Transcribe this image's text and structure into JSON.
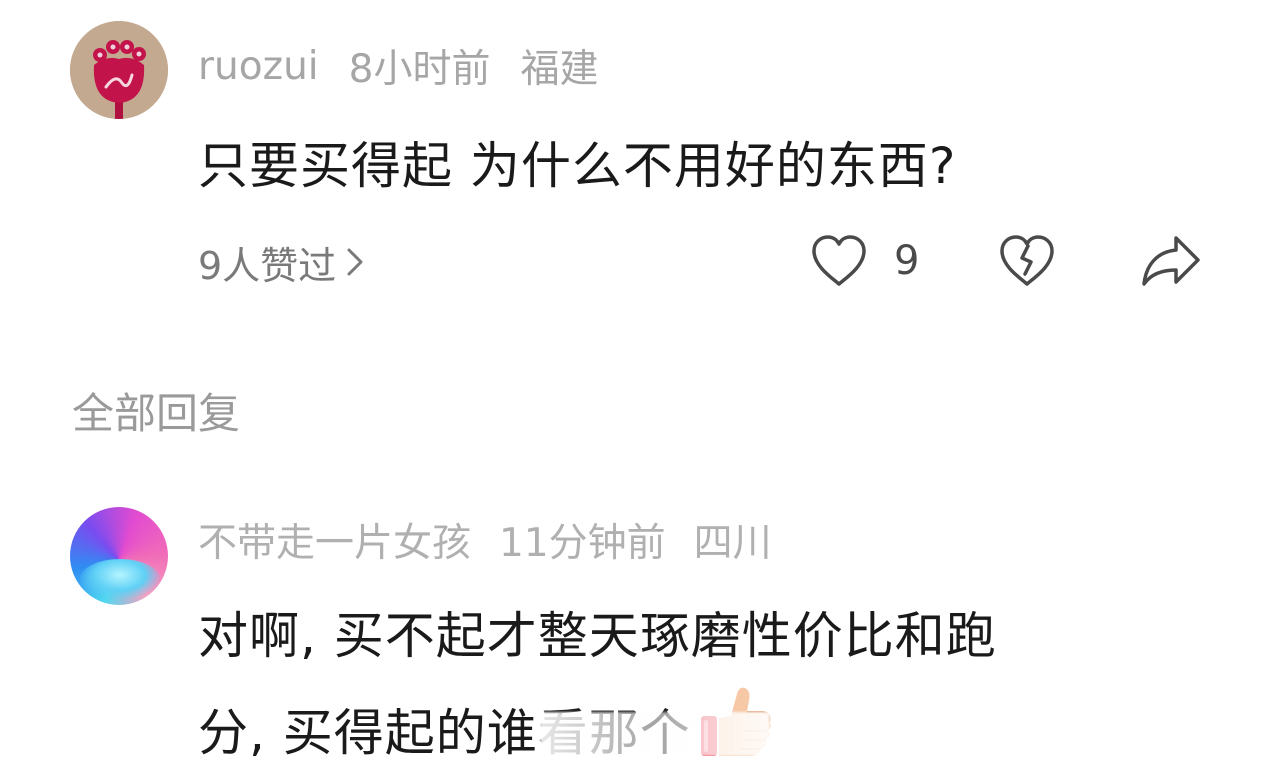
{
  "comment": {
    "username": "ruozui",
    "time": "8小时前",
    "location": "福建",
    "text": "只要买得起 为什么不用好的东西?",
    "likes_link": "9人赞过",
    "like_count": "9"
  },
  "replies_header": "全部回复",
  "reply": {
    "username": "不带走一片女孩",
    "time": "11分钟前",
    "location": "四川",
    "text_line1": "对啊, 买不起才整天琢磨性价比和跑",
    "text_line2": "分, 买得起的谁看那个",
    "emoji": "thumbs-up-emoji"
  },
  "icons": {
    "like": "heart-outline-icon",
    "dislike": "broken-heart-icon",
    "share": "share-arrow-icon",
    "chevron": "chevron-right-icon"
  },
  "colors": {
    "avatar1_bg": "#c4a991",
    "avatar1_flower": "#c2134a",
    "meta_text": "#a6a6a6",
    "body_text": "#1a1a1a"
  }
}
